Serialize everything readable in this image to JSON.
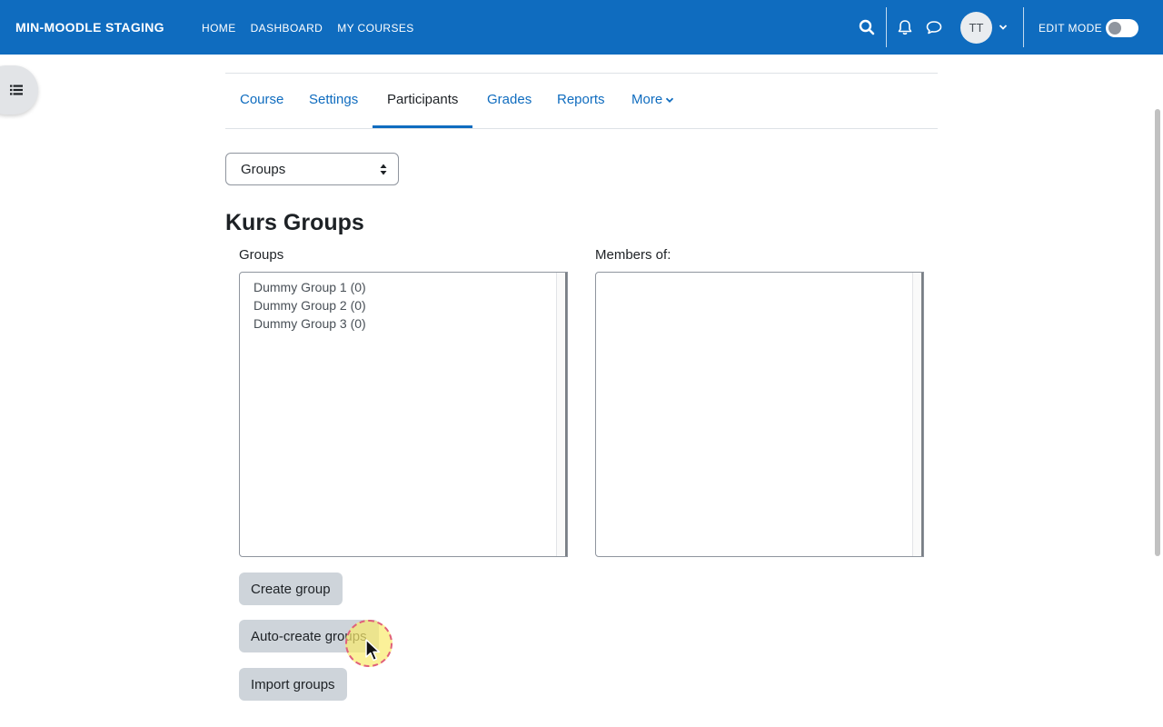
{
  "navbar": {
    "brand": "MIN-MOODLE STAGING",
    "links": [
      "HOME",
      "DASHBOARD",
      "MY COURSES"
    ],
    "avatar_initials": "TT",
    "edit_mode_label": "EDIT MODE",
    "edit_mode_on": false,
    "background_color": "#0f6cbf",
    "icons": [
      "search-icon",
      "bell-icon",
      "chat-icon",
      "chevron-down-icon"
    ]
  },
  "drawer": {
    "icon": "list-icon"
  },
  "tabs": {
    "items": [
      "Course",
      "Settings",
      "Participants",
      "Grades",
      "Reports",
      "More"
    ],
    "active": "Participants"
  },
  "page_select": {
    "value": "Groups"
  },
  "page": {
    "title": "Kurs Groups",
    "groups_label": "Groups",
    "members_label": "Members of:",
    "groups": [
      "Dummy Group 1 (0)",
      "Dummy Group 2 (0)",
      "Dummy Group 3 (0)"
    ],
    "members": []
  },
  "buttons": {
    "create_group": "Create group",
    "auto_create_groups": "Auto-create groups",
    "import_groups": "Import groups"
  },
  "colors": {
    "link": "#0f6cbf",
    "button_bg": "#ced4da",
    "text": "#1d2125"
  }
}
